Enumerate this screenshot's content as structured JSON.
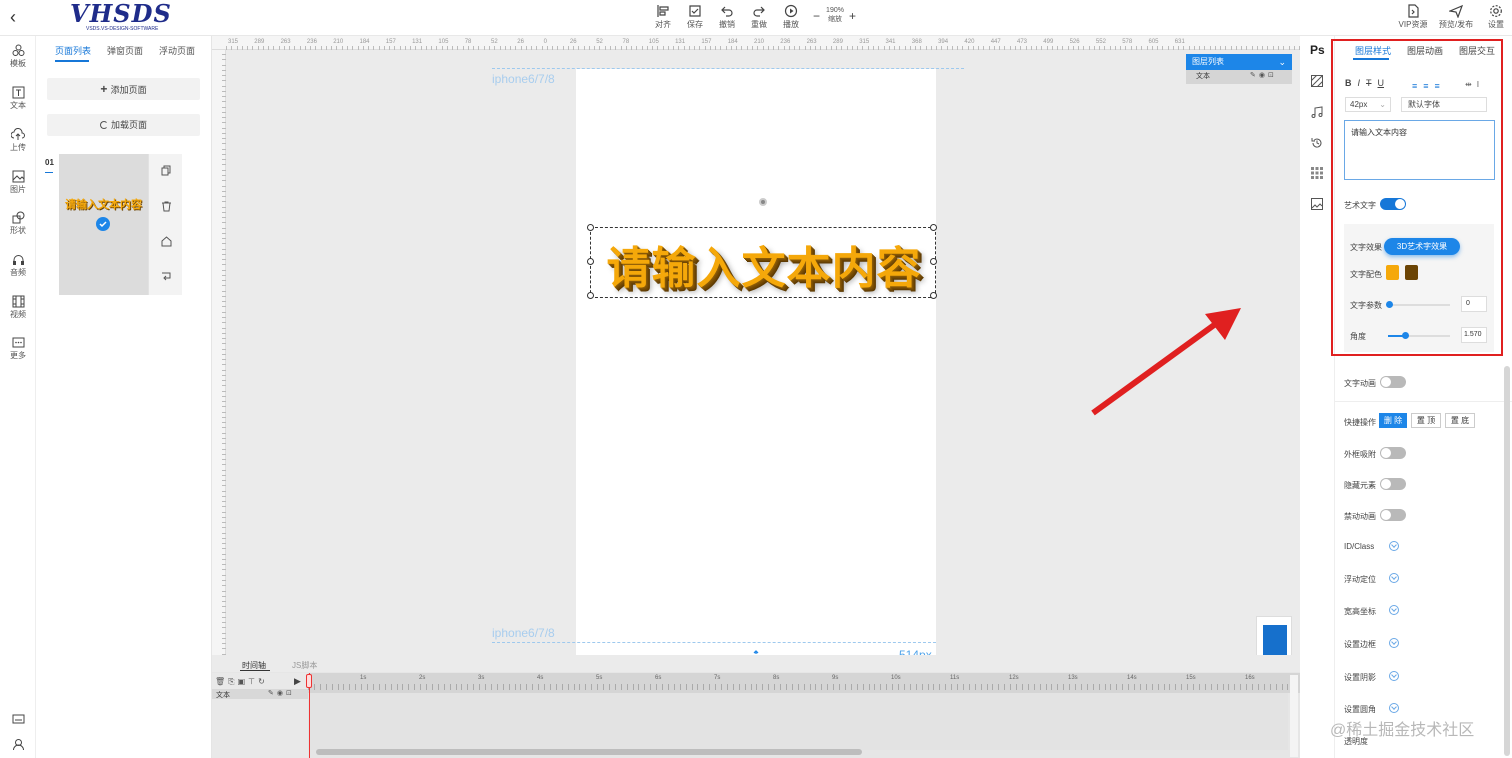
{
  "topbar": {
    "tools": [
      {
        "label": "对齐",
        "icon": "align-icon"
      },
      {
        "label": "保存",
        "icon": "save-icon"
      },
      {
        "label": "撤销",
        "icon": "undo-icon"
      },
      {
        "label": "重做",
        "icon": "redo-icon"
      },
      {
        "label": "播放",
        "icon": "play-icon"
      }
    ],
    "zoom_value": "190%",
    "zoom_label": "缩放",
    "zoom_minus": "−",
    "zoom_plus": "+",
    "vip": "VIP资源",
    "preview": "预览/发布",
    "settings": "设置",
    "logo_text": "VHSDS",
    "logo_sub": "VSDS.VS-DESIGN-SOFTWARE"
  },
  "leftrail": {
    "back": "‹",
    "items": [
      "模板",
      "文本",
      "上传",
      "图片",
      "形状",
      "音频",
      "视频",
      "更多"
    ]
  },
  "pages": {
    "tabs": [
      "页面列表",
      "弹窗页面",
      "浮动页面"
    ],
    "add_page": "添加页面",
    "load_page": "加载页面",
    "page_index": "01",
    "thumb_text": "请输入文本内容"
  },
  "canvas": {
    "ruler_numbers": [
      "315",
      "289",
      "263",
      "236",
      "210",
      "184",
      "157",
      "131",
      "105",
      "78",
      "52",
      "26",
      "0",
      "26",
      "52",
      "78",
      "105",
      "131",
      "157",
      "184",
      "210",
      "236",
      "263",
      "289",
      "315",
      "341",
      "368",
      "394",
      "420",
      "447",
      "473",
      "499",
      "526",
      "552",
      "578",
      "605",
      "631"
    ],
    "device_label": "iphone6/7/8",
    "height_label": "514px",
    "text": "请输入文本内容",
    "layer_list_title": "图层列表",
    "layer_item": "文本"
  },
  "timeline": {
    "tabs": [
      "时间轴",
      "JS脚本"
    ],
    "track_label": "文本",
    "seconds": [
      "1s",
      "2s",
      "3s",
      "4s",
      "5s",
      "6s",
      "7s",
      "8s",
      "9s",
      "10s",
      "11s",
      "12s",
      "13s",
      "14s",
      "15s",
      "16s"
    ]
  },
  "rightstrip": {
    "ps": "Ps"
  },
  "props": {
    "tabs": [
      "图层样式",
      "图层动画",
      "图层交互"
    ],
    "format": [
      "B",
      "I",
      "T",
      "U"
    ],
    "font_size": "42px",
    "font_family": "默认字体",
    "text_content": "请输入文本内容",
    "art_text_label": "艺术文字",
    "effect_label": "文字效果",
    "effect_value": "3D艺术字效果",
    "color_label": "文字配色",
    "color_1": "#f5a80a",
    "color_2": "#6b4405",
    "param_label": "文字参数",
    "param_value": "0",
    "angle_label": "角度",
    "angle_value": "1.570",
    "anim_label": "文字动画",
    "quick_label": "快捷操作",
    "quick_buttons": [
      "删 除",
      "置 顶",
      "置 底"
    ],
    "rows": [
      {
        "label": "外框吸附",
        "type": "toggle"
      },
      {
        "label": "隐藏元素",
        "type": "toggle"
      },
      {
        "label": "禁动动画",
        "type": "toggle"
      },
      {
        "label": "ID/Class",
        "type": "chev"
      },
      {
        "label": "浮动定位",
        "type": "chev"
      },
      {
        "label": "宽高坐标",
        "type": "chev"
      },
      {
        "label": "设置边框",
        "type": "chev"
      },
      {
        "label": "设置阴影",
        "type": "chev"
      },
      {
        "label": "设置圆角",
        "type": "chev"
      },
      {
        "label": "透明度",
        "type": "chev"
      }
    ]
  },
  "watermark": "@稀土掘金技术社区"
}
